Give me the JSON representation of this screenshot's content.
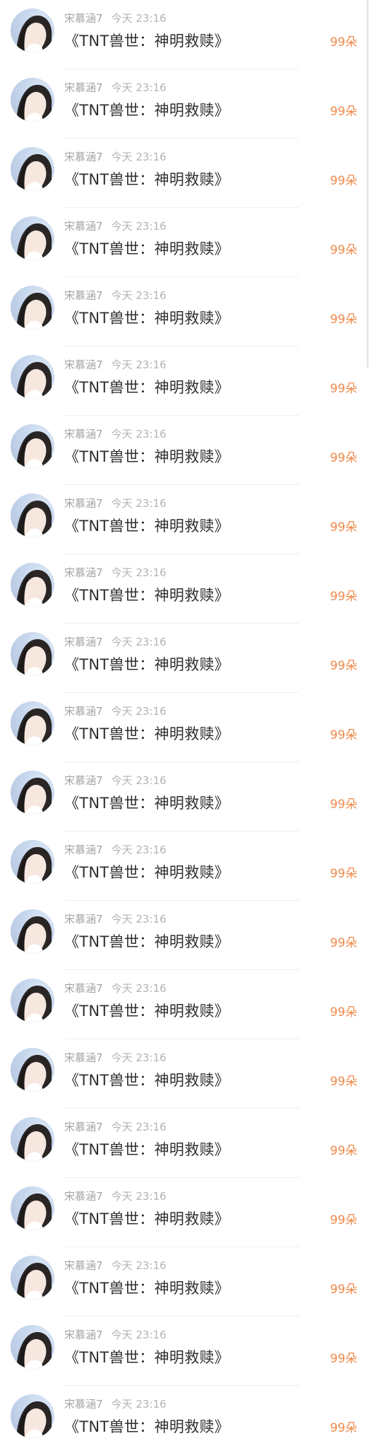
{
  "colors": {
    "count": "#f08a4b",
    "name": "#a3a3a3",
    "title": "#2f2f2f"
  },
  "items": [
    {
      "user": "宋慕涵7",
      "time": "今天 23:16",
      "title": "《TNT兽世：神明救赎》",
      "count": "99朵",
      "avatar_icon": "user-avatar"
    },
    {
      "user": "宋慕涵7",
      "time": "今天 23:16",
      "title": "《TNT兽世：神明救赎》",
      "count": "99朵",
      "avatar_icon": "user-avatar"
    },
    {
      "user": "宋慕涵7",
      "time": "今天 23:16",
      "title": "《TNT兽世：神明救赎》",
      "count": "99朵",
      "avatar_icon": "user-avatar"
    },
    {
      "user": "宋慕涵7",
      "time": "今天 23:16",
      "title": "《TNT兽世：神明救赎》",
      "count": "99朵",
      "avatar_icon": "user-avatar"
    },
    {
      "user": "宋慕涵7",
      "time": "今天 23:16",
      "title": "《TNT兽世：神明救赎》",
      "count": "99朵",
      "avatar_icon": "user-avatar"
    },
    {
      "user": "宋慕涵7",
      "time": "今天 23:16",
      "title": "《TNT兽世：神明救赎》",
      "count": "99朵",
      "avatar_icon": "user-avatar"
    },
    {
      "user": "宋慕涵7",
      "time": "今天 23:16",
      "title": "《TNT兽世：神明救赎》",
      "count": "99朵",
      "avatar_icon": "user-avatar"
    },
    {
      "user": "宋慕涵7",
      "time": "今天 23:16",
      "title": "《TNT兽世：神明救赎》",
      "count": "99朵",
      "avatar_icon": "user-avatar"
    },
    {
      "user": "宋慕涵7",
      "time": "今天 23:16",
      "title": "《TNT兽世：神明救赎》",
      "count": "99朵",
      "avatar_icon": "user-avatar"
    },
    {
      "user": "宋慕涵7",
      "time": "今天 23:16",
      "title": "《TNT兽世：神明救赎》",
      "count": "99朵",
      "avatar_icon": "user-avatar"
    },
    {
      "user": "宋慕涵7",
      "time": "今天 23:16",
      "title": "《TNT兽世：神明救赎》",
      "count": "99朵",
      "avatar_icon": "user-avatar"
    },
    {
      "user": "宋慕涵7",
      "time": "今天 23:16",
      "title": "《TNT兽世：神明救赎》",
      "count": "99朵",
      "avatar_icon": "user-avatar"
    },
    {
      "user": "宋慕涵7",
      "time": "今天 23:16",
      "title": "《TNT兽世：神明救赎》",
      "count": "99朵",
      "avatar_icon": "user-avatar"
    },
    {
      "user": "宋慕涵7",
      "time": "今天 23:16",
      "title": "《TNT兽世：神明救赎》",
      "count": "99朵",
      "avatar_icon": "user-avatar"
    },
    {
      "user": "宋慕涵7",
      "time": "今天 23:16",
      "title": "《TNT兽世：神明救赎》",
      "count": "99朵",
      "avatar_icon": "user-avatar"
    },
    {
      "user": "宋慕涵7",
      "time": "今天 23:16",
      "title": "《TNT兽世：神明救赎》",
      "count": "99朵",
      "avatar_icon": "user-avatar"
    },
    {
      "user": "宋慕涵7",
      "time": "今天 23:16",
      "title": "《TNT兽世：神明救赎》",
      "count": "99朵",
      "avatar_icon": "user-avatar"
    },
    {
      "user": "宋慕涵7",
      "time": "今天 23:16",
      "title": "《TNT兽世：神明救赎》",
      "count": "99朵",
      "avatar_icon": "user-avatar"
    },
    {
      "user": "宋慕涵7",
      "time": "今天 23:16",
      "title": "《TNT兽世：神明救赎》",
      "count": "99朵",
      "avatar_icon": "user-avatar"
    },
    {
      "user": "宋慕涵7",
      "time": "今天 23:16",
      "title": "《TNT兽世：神明救赎》",
      "count": "99朵",
      "avatar_icon": "user-avatar"
    },
    {
      "user": "宋慕涵7",
      "time": "今天 23:16",
      "title": "《TNT兽世：神明救赎》",
      "count": "99朵",
      "avatar_icon": "user-avatar"
    }
  ]
}
